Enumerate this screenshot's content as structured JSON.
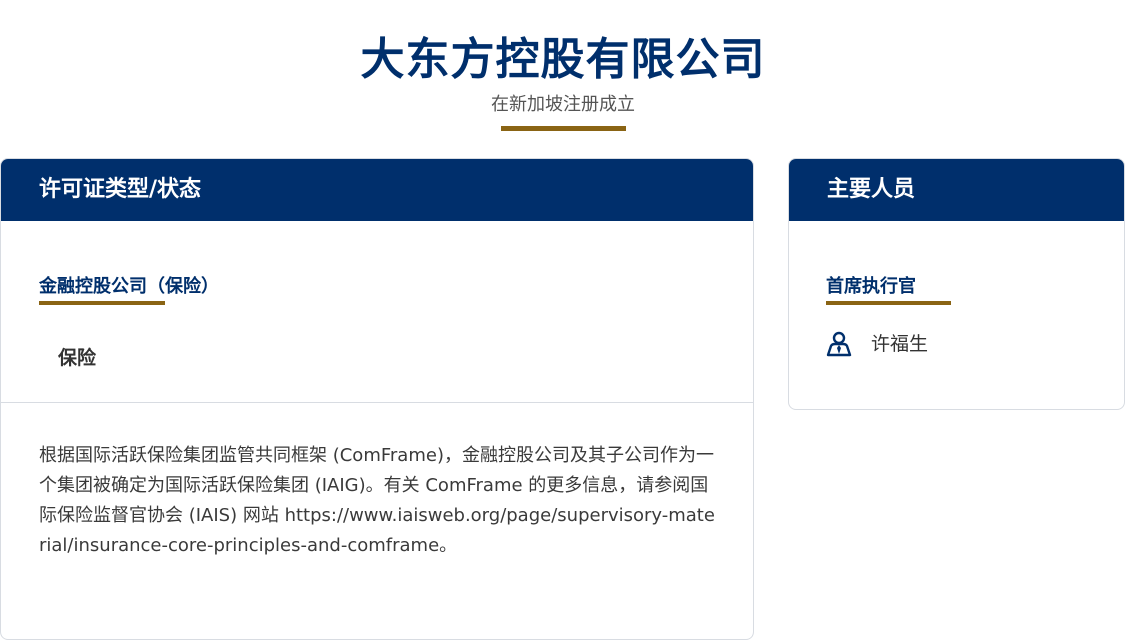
{
  "header": {
    "title": "大东方控股有限公司",
    "subtitle": "在新加坡注册成立"
  },
  "license_card": {
    "heading": "许可证类型/状态",
    "license_type": "金融控股公司（保险）",
    "license_item": "保险",
    "note": "根据国际活跃保险集团监管共同框架 (ComFrame)，金融控股公司及其子公司作为一个集团被确定为国际活跃保险集团 (IAIG)。有关 ComFrame 的更多信息，请参阅国际保险监督官协会 (IAIS) 网站 https://www.iaisweb.org/page/supervisory-material/insurance-core-principles-and-comframe。"
  },
  "people_card": {
    "heading": "主要人员",
    "role": "首席执行官",
    "person_name": "许福生",
    "person_icon": "person-icon"
  },
  "colors": {
    "navy": "#002f6c",
    "gold": "#8a6414",
    "text": "#333333",
    "border": "#d8dce2"
  }
}
